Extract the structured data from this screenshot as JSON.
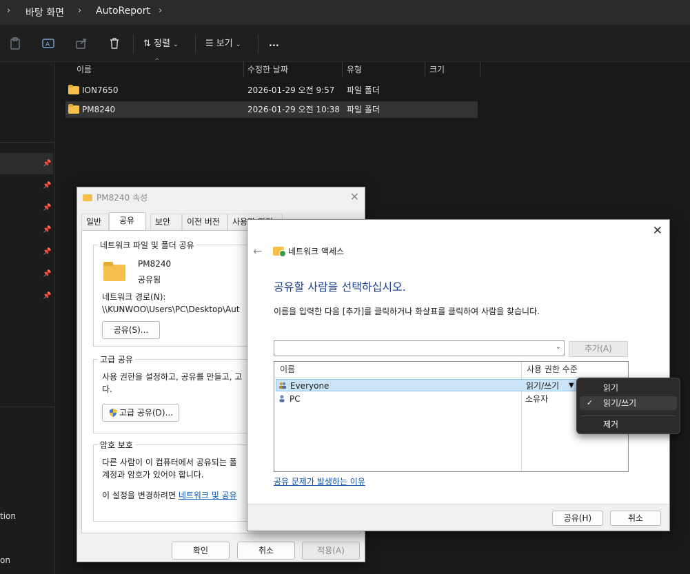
{
  "explorer": {
    "breadcrumb": [
      "바탕 화면",
      "AutoReport"
    ],
    "toolbar": {
      "sort_label": "정렬",
      "view_label": "보기",
      "more_label": "..."
    },
    "columns": [
      "이름",
      "수정한 날짜",
      "유형",
      "크기"
    ],
    "files": [
      {
        "name": "ION7650",
        "date": "2026-01-29 오전 9:57",
        "type": "파일 폴더",
        "selected": false
      },
      {
        "name": "PM8240",
        "date": "2026-01-29 오전 10:38",
        "type": "파일 폴더",
        "selected": true
      }
    ],
    "nav_partial_items": [
      "tion",
      "on"
    ]
  },
  "properties": {
    "title": "PM8240 속성",
    "tabs": [
      "일반",
      "공유",
      "보안",
      "이전 버전",
      "사용자 지정"
    ],
    "active_tab": "공유",
    "network_share": {
      "group_label": "네트워크 파일 및 폴더 공유",
      "folder_name": "PM8240",
      "status": "공유됨",
      "path_label": "네트워크 경로(N):",
      "path_value": "\\\\KUNWOO\\Users\\PC\\Desktop\\Aut",
      "share_button": "공유(S)..."
    },
    "advanced": {
      "group_label": "고급 공유",
      "desc_line1": "사용 권한을 설정하고, 공유를 만들고, 고",
      "desc_line2": "다.",
      "button": "고급 공유(D)..."
    },
    "password": {
      "group_label": "암호 보호",
      "line1": "다른 사람이 이 컴퓨터에서 공유되는 폴",
      "line2": "계정과 암호가 있어야 합니다.",
      "line3_prefix": "이 설정을 변경하려면 ",
      "line3_link": "네트워크 및 공유"
    },
    "buttons": {
      "ok": "확인",
      "cancel": "취소",
      "apply": "적용(A)"
    }
  },
  "network_access": {
    "window_title": "네트워크 액세스",
    "heading": "공유할 사람을 선택하십시오.",
    "instruction": "이름을 입력한 다음 [추가]를 클릭하거나 화살표를 클릭하여 사람을 찾습니다.",
    "add_button": "추가(A)",
    "list_headers": [
      "이름",
      "사용 권한 수준"
    ],
    "users": [
      {
        "name": "Everyone",
        "permission": "읽기/쓰기",
        "selected": true
      },
      {
        "name": "PC",
        "permission": "소유자",
        "selected": false
      }
    ],
    "help_link": "공유 문제가 발생하는 이유",
    "share_button": "공유(H)",
    "cancel_button": "취소"
  },
  "context_menu": {
    "items": [
      {
        "label": "읽기",
        "checked": false
      },
      {
        "label": "읽기/쓰기",
        "checked": true
      }
    ],
    "remove_label": "제거"
  },
  "colors": {
    "explorer_bg": "#191919",
    "dialog_bg": "#f0f0f0",
    "heading_blue": "#1a3f8f",
    "link_blue": "#0a57b8",
    "selection_blue": "#cce4f7",
    "folder_yellow": "#f5c04a"
  }
}
